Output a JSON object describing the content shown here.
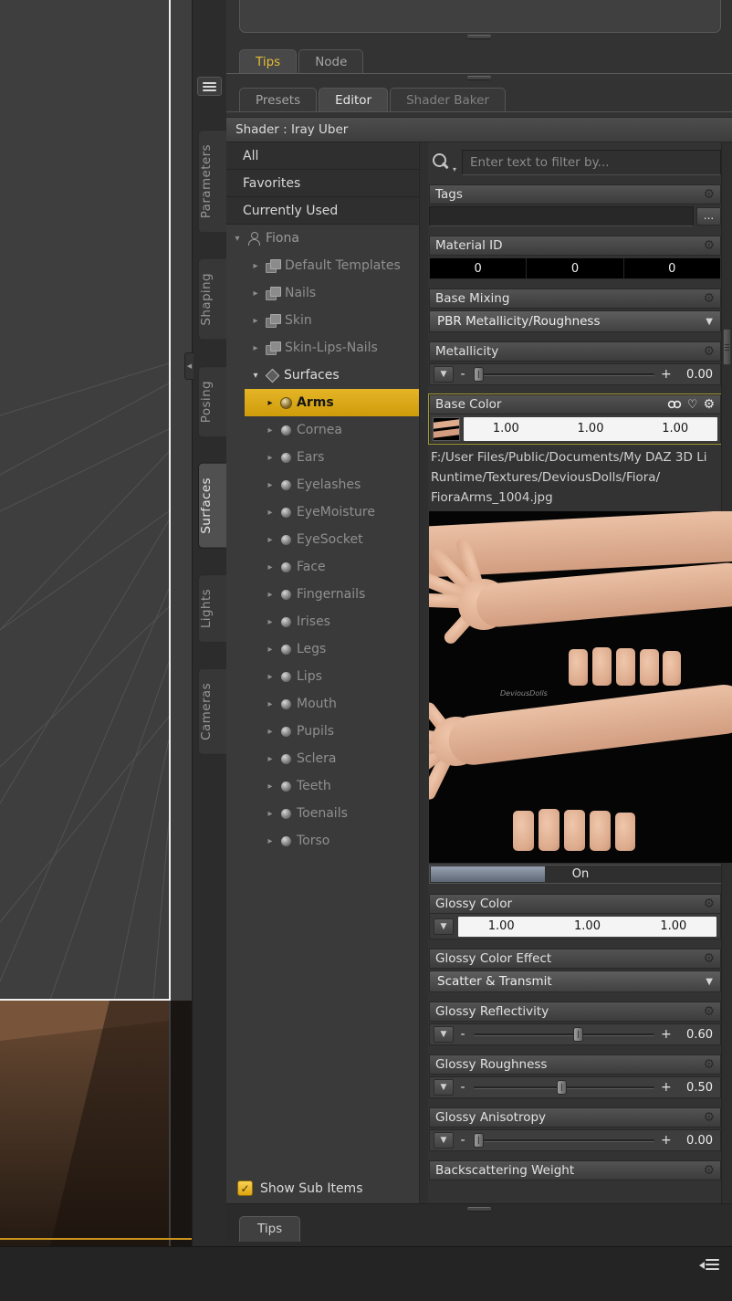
{
  "ui_colors": {
    "accent_selection": "#d9a511",
    "tab_highlight_text": "#e3bc36",
    "viewport_frame": "#efefef",
    "viewport_border": "#c9931c"
  },
  "doc_tabs": {
    "tips": "Tips",
    "node": "Node"
  },
  "mode_tabs": {
    "presets": "Presets",
    "editor": "Editor",
    "shader_baker": "Shader Baker"
  },
  "shader_bar": {
    "label": "Shader : Iray Uber"
  },
  "side_tabs": [
    {
      "label": "Parameters",
      "selected": false
    },
    {
      "label": "Shaping",
      "selected": false
    },
    {
      "label": "Posing",
      "selected": false
    },
    {
      "label": "Surfaces",
      "selected": true
    },
    {
      "label": "Lights",
      "selected": false
    },
    {
      "label": "Cameras",
      "selected": false
    }
  ],
  "tree": {
    "static_items": [
      {
        "label": "All"
      },
      {
        "label": "Favorites"
      },
      {
        "label": "Currently Used"
      }
    ],
    "root_label": "Fiona",
    "groups": [
      {
        "label": "Default Templates"
      },
      {
        "label": "Nails"
      },
      {
        "label": "Skin"
      },
      {
        "label": "Skin-Lips-Nails"
      }
    ],
    "surfaces_label": "Surfaces",
    "surfaces": [
      {
        "label": "Arms",
        "selected": true
      },
      {
        "label": "Cornea"
      },
      {
        "label": "Ears"
      },
      {
        "label": "Eyelashes"
      },
      {
        "label": "EyeMoisture"
      },
      {
        "label": "EyeSocket"
      },
      {
        "label": "Face"
      },
      {
        "label": "Fingernails"
      },
      {
        "label": "Irises"
      },
      {
        "label": "Legs"
      },
      {
        "label": "Lips"
      },
      {
        "label": "Mouth"
      },
      {
        "label": "Pupils"
      },
      {
        "label": "Sclera"
      },
      {
        "label": "Teeth"
      },
      {
        "label": "Toenails"
      },
      {
        "label": "Torso"
      }
    ],
    "show_sub_items_label": "Show Sub Items"
  },
  "props": {
    "filter_placeholder": "Enter text to filter by...",
    "tags": {
      "label": "Tags",
      "value": "",
      "more_button": "..."
    },
    "material_id": {
      "label": "Material ID",
      "values": [
        "0",
        "0",
        "0"
      ]
    },
    "base_mixing": {
      "label": "Base Mixing",
      "value": "PBR Metallicity/Roughness"
    },
    "metallicity": {
      "label": "Metallicity",
      "value": "0.00"
    },
    "base_color": {
      "label": "Base Color",
      "r": "1.00",
      "g": "1.00",
      "b": "1.00"
    },
    "texture_tooltip": {
      "line1": "F:/User Files/Public/Documents/My DAZ 3D Li",
      "line2": "Runtime/Textures/DeviousDolls/Fiora/",
      "line3": "FioraArms_1004.jpg"
    },
    "texture_watermark": "DeviousDolls",
    "on_label": "On",
    "glossy_color": {
      "label": "Glossy Color",
      "r": "1.00",
      "g": "1.00",
      "b": "1.00"
    },
    "glossy_color_effect": {
      "label": "Glossy Color Effect",
      "value": "Scatter & Transmit"
    },
    "glossy_reflectivity": {
      "label": "Glossy Reflectivity",
      "value": "0.60"
    },
    "glossy_roughness": {
      "label": "Glossy Roughness",
      "value": "0.50"
    },
    "glossy_anisotropy": {
      "label": "Glossy Anisotropy",
      "value": "0.00"
    },
    "backscattering": {
      "label": "Backscattering Weight"
    }
  },
  "bottom": {
    "tips_tab": "Tips"
  }
}
